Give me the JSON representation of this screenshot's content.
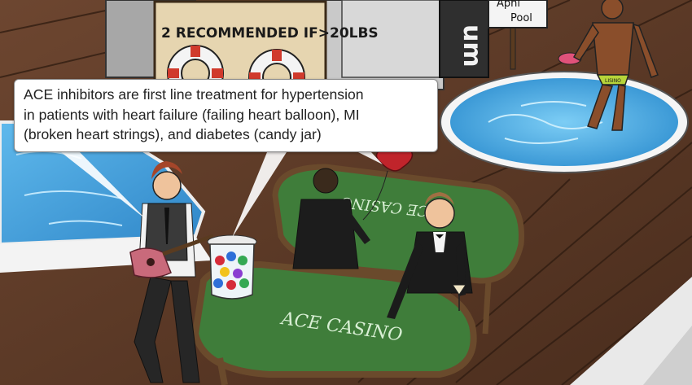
{
  "caption": {
    "lines": [
      "ACE inhibitors are first line treatment for hypertension",
      "in patients with heart failure (failing heart balloon), MI",
      "(broken heart strings), and diabetes (candy jar)"
    ]
  },
  "scene": {
    "sign_text": "2 RECOMMENDED IF>20LBS",
    "pool_sign_top": "Aphl",
    "pool_sign_bottom": "Pool",
    "vertical_sign": "um",
    "table_back_text": "ACE CASINO",
    "table_front_text": "ACE CASINO",
    "swimsuit_text": "LISINO",
    "colors": {
      "deck": "#5a3a26",
      "pool_water": "#3ea2df",
      "felt": "#3f7d3a",
      "caption_bg": "#ffffff"
    }
  }
}
